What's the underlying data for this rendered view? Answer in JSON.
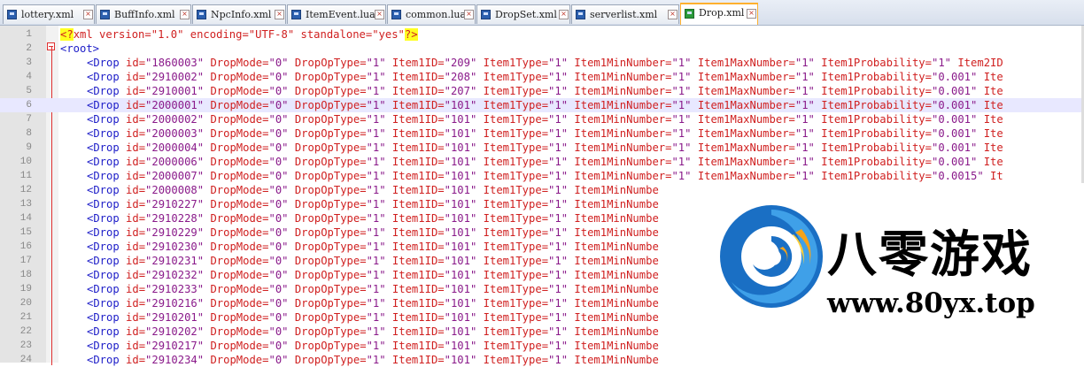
{
  "tabs": [
    {
      "label": "lottery.xml",
      "active": false
    },
    {
      "label": "BuffInfo.xml",
      "active": false
    },
    {
      "label": "NpcInfo.xml",
      "active": false
    },
    {
      "label": "ItemEvent.lua",
      "active": false
    },
    {
      "label": "common.lua",
      "active": false
    },
    {
      "label": "DropSet.xml",
      "active": false
    },
    {
      "label": "serverlist.xml",
      "active": false
    },
    {
      "label": "Drop.xml",
      "active": true
    }
  ],
  "tab_close_glyph": "×",
  "editor": {
    "line_numbers": [
      "1",
      "2",
      "3",
      "4",
      "5",
      "6",
      "7",
      "8",
      "9",
      "10",
      "11",
      "12",
      "13",
      "14",
      "15",
      "16",
      "17",
      "18",
      "19",
      "20",
      "21",
      "22",
      "23",
      "24"
    ],
    "line1": {
      "pi_open": "<?",
      "rest": "xml version=\"1.0\" encoding=\"UTF-8\" standalone=\"yes\"",
      "pi_close": "?>"
    },
    "line2": "<root>",
    "rows": [
      {
        "text": "<Drop id=\"1860003\" DropMode=\"0\" DropOpType=\"1\" Item1ID=\"209\" Item1Type=\"1\" Item1MinNumber=\"1\" Item1MaxNumber=\"1\" Item1Probability=\"1\" Item2ID"
      },
      {
        "text": "<Drop id=\"2910002\" DropMode=\"0\" DropOpType=\"1\" Item1ID=\"208\" Item1Type=\"1\" Item1MinNumber=\"1\" Item1MaxNumber=\"1\" Item1Probability=\"0.001\" Ite"
      },
      {
        "text": "<Drop id=\"2910001\" DropMode=\"0\" DropOpType=\"1\" Item1ID=\"207\" Item1Type=\"1\" Item1MinNumber=\"1\" Item1MaxNumber=\"1\" Item1Probability=\"0.001\" Ite"
      },
      {
        "text": "<Drop id=\"2000001\" DropMode=\"0\" DropOpType=\"1\" Item1ID=\"101\" Item1Type=\"1\" Item1MinNumber=\"1\" Item1MaxNumber=\"1\" Item1Probability=\"0.001\" Ite"
      },
      {
        "text": "<Drop id=\"2000002\" DropMode=\"0\" DropOpType=\"1\" Item1ID=\"101\" Item1Type=\"1\" Item1MinNumber=\"1\" Item1MaxNumber=\"1\" Item1Probability=\"0.001\" Ite"
      },
      {
        "text": "<Drop id=\"2000003\" DropMode=\"0\" DropOpType=\"1\" Item1ID=\"101\" Item1Type=\"1\" Item1MinNumber=\"1\" Item1MaxNumber=\"1\" Item1Probability=\"0.001\" Ite"
      },
      {
        "text": "<Drop id=\"2000004\" DropMode=\"0\" DropOpType=\"1\" Item1ID=\"101\" Item1Type=\"1\" Item1MinNumber=\"1\" Item1MaxNumber=\"1\" Item1Probability=\"0.001\" Ite"
      },
      {
        "text": "<Drop id=\"2000006\" DropMode=\"0\" DropOpType=\"1\" Item1ID=\"101\" Item1Type=\"1\" Item1MinNumber=\"1\" Item1MaxNumber=\"1\" Item1Probability=\"0.001\" Ite"
      },
      {
        "text": "<Drop id=\"2000007\" DropMode=\"0\" DropOpType=\"1\" Item1ID=\"101\" Item1Type=\"1\" Item1MinNumber=\"1\" Item1MaxNumber=\"1\" Item1Probability=\"0.0015\" It"
      },
      {
        "text": "<Drop id=\"2000008\" DropMode=\"0\" DropOpType=\"1\" Item1ID=\"101\" Item1Type=\"1\" Item1MinNumbe"
      },
      {
        "text": "<Drop id=\"2910227\" DropMode=\"0\" DropOpType=\"1\" Item1ID=\"101\" Item1Type=\"1\" Item1MinNumbe"
      },
      {
        "text": "<Drop id=\"2910228\" DropMode=\"0\" DropOpType=\"1\" Item1ID=\"101\" Item1Type=\"1\" Item1MinNumbe"
      },
      {
        "text": "<Drop id=\"2910229\" DropMode=\"0\" DropOpType=\"1\" Item1ID=\"101\" Item1Type=\"1\" Item1MinNumbe"
      },
      {
        "text": "<Drop id=\"2910230\" DropMode=\"0\" DropOpType=\"1\" Item1ID=\"101\" Item1Type=\"1\" Item1MinNumbe"
      },
      {
        "text": "<Drop id=\"2910231\" DropMode=\"0\" DropOpType=\"1\" Item1ID=\"101\" Item1Type=\"1\" Item1MinNumbe"
      },
      {
        "text": "<Drop id=\"2910232\" DropMode=\"0\" DropOpType=\"1\" Item1ID=\"101\" Item1Type=\"1\" Item1MinNumbe"
      },
      {
        "text": "<Drop id=\"2910233\" DropMode=\"0\" DropOpType=\"1\" Item1ID=\"101\" Item1Type=\"1\" Item1MinNumbe"
      },
      {
        "text": "<Drop id=\"2910216\" DropMode=\"0\" DropOpType=\"1\" Item1ID=\"101\" Item1Type=\"1\" Item1MinNumbe"
      },
      {
        "text": "<Drop id=\"2910201\" DropMode=\"0\" DropOpType=\"1\" Item1ID=\"101\" Item1Type=\"1\" Item1MinNumbe"
      },
      {
        "text": "<Drop id=\"2910202\" DropMode=\"0\" DropOpType=\"1\" Item1ID=\"101\" Item1Type=\"1\" Item1MinNumbe"
      },
      {
        "text": "<Drop id=\"2910217\" DropMode=\"0\" DropOpType=\"1\" Item1ID=\"101\" Item1Type=\"1\" Item1MinNumbe"
      },
      {
        "text": "<Drop id=\"2910234\" DropMode=\"0\" DropOpType=\"1\" Item1ID=\"101\" Item1Type=\"1\" Item1MinNumbe"
      }
    ],
    "highlighted_line": "6",
    "colors": {
      "tag": "#1d1dc8",
      "attribute": "#d02020",
      "value": "#8a1a8a",
      "highlight": "#e8e8ff"
    }
  },
  "watermark": {
    "title": "八零游戏",
    "url": "www.80yx.top"
  }
}
